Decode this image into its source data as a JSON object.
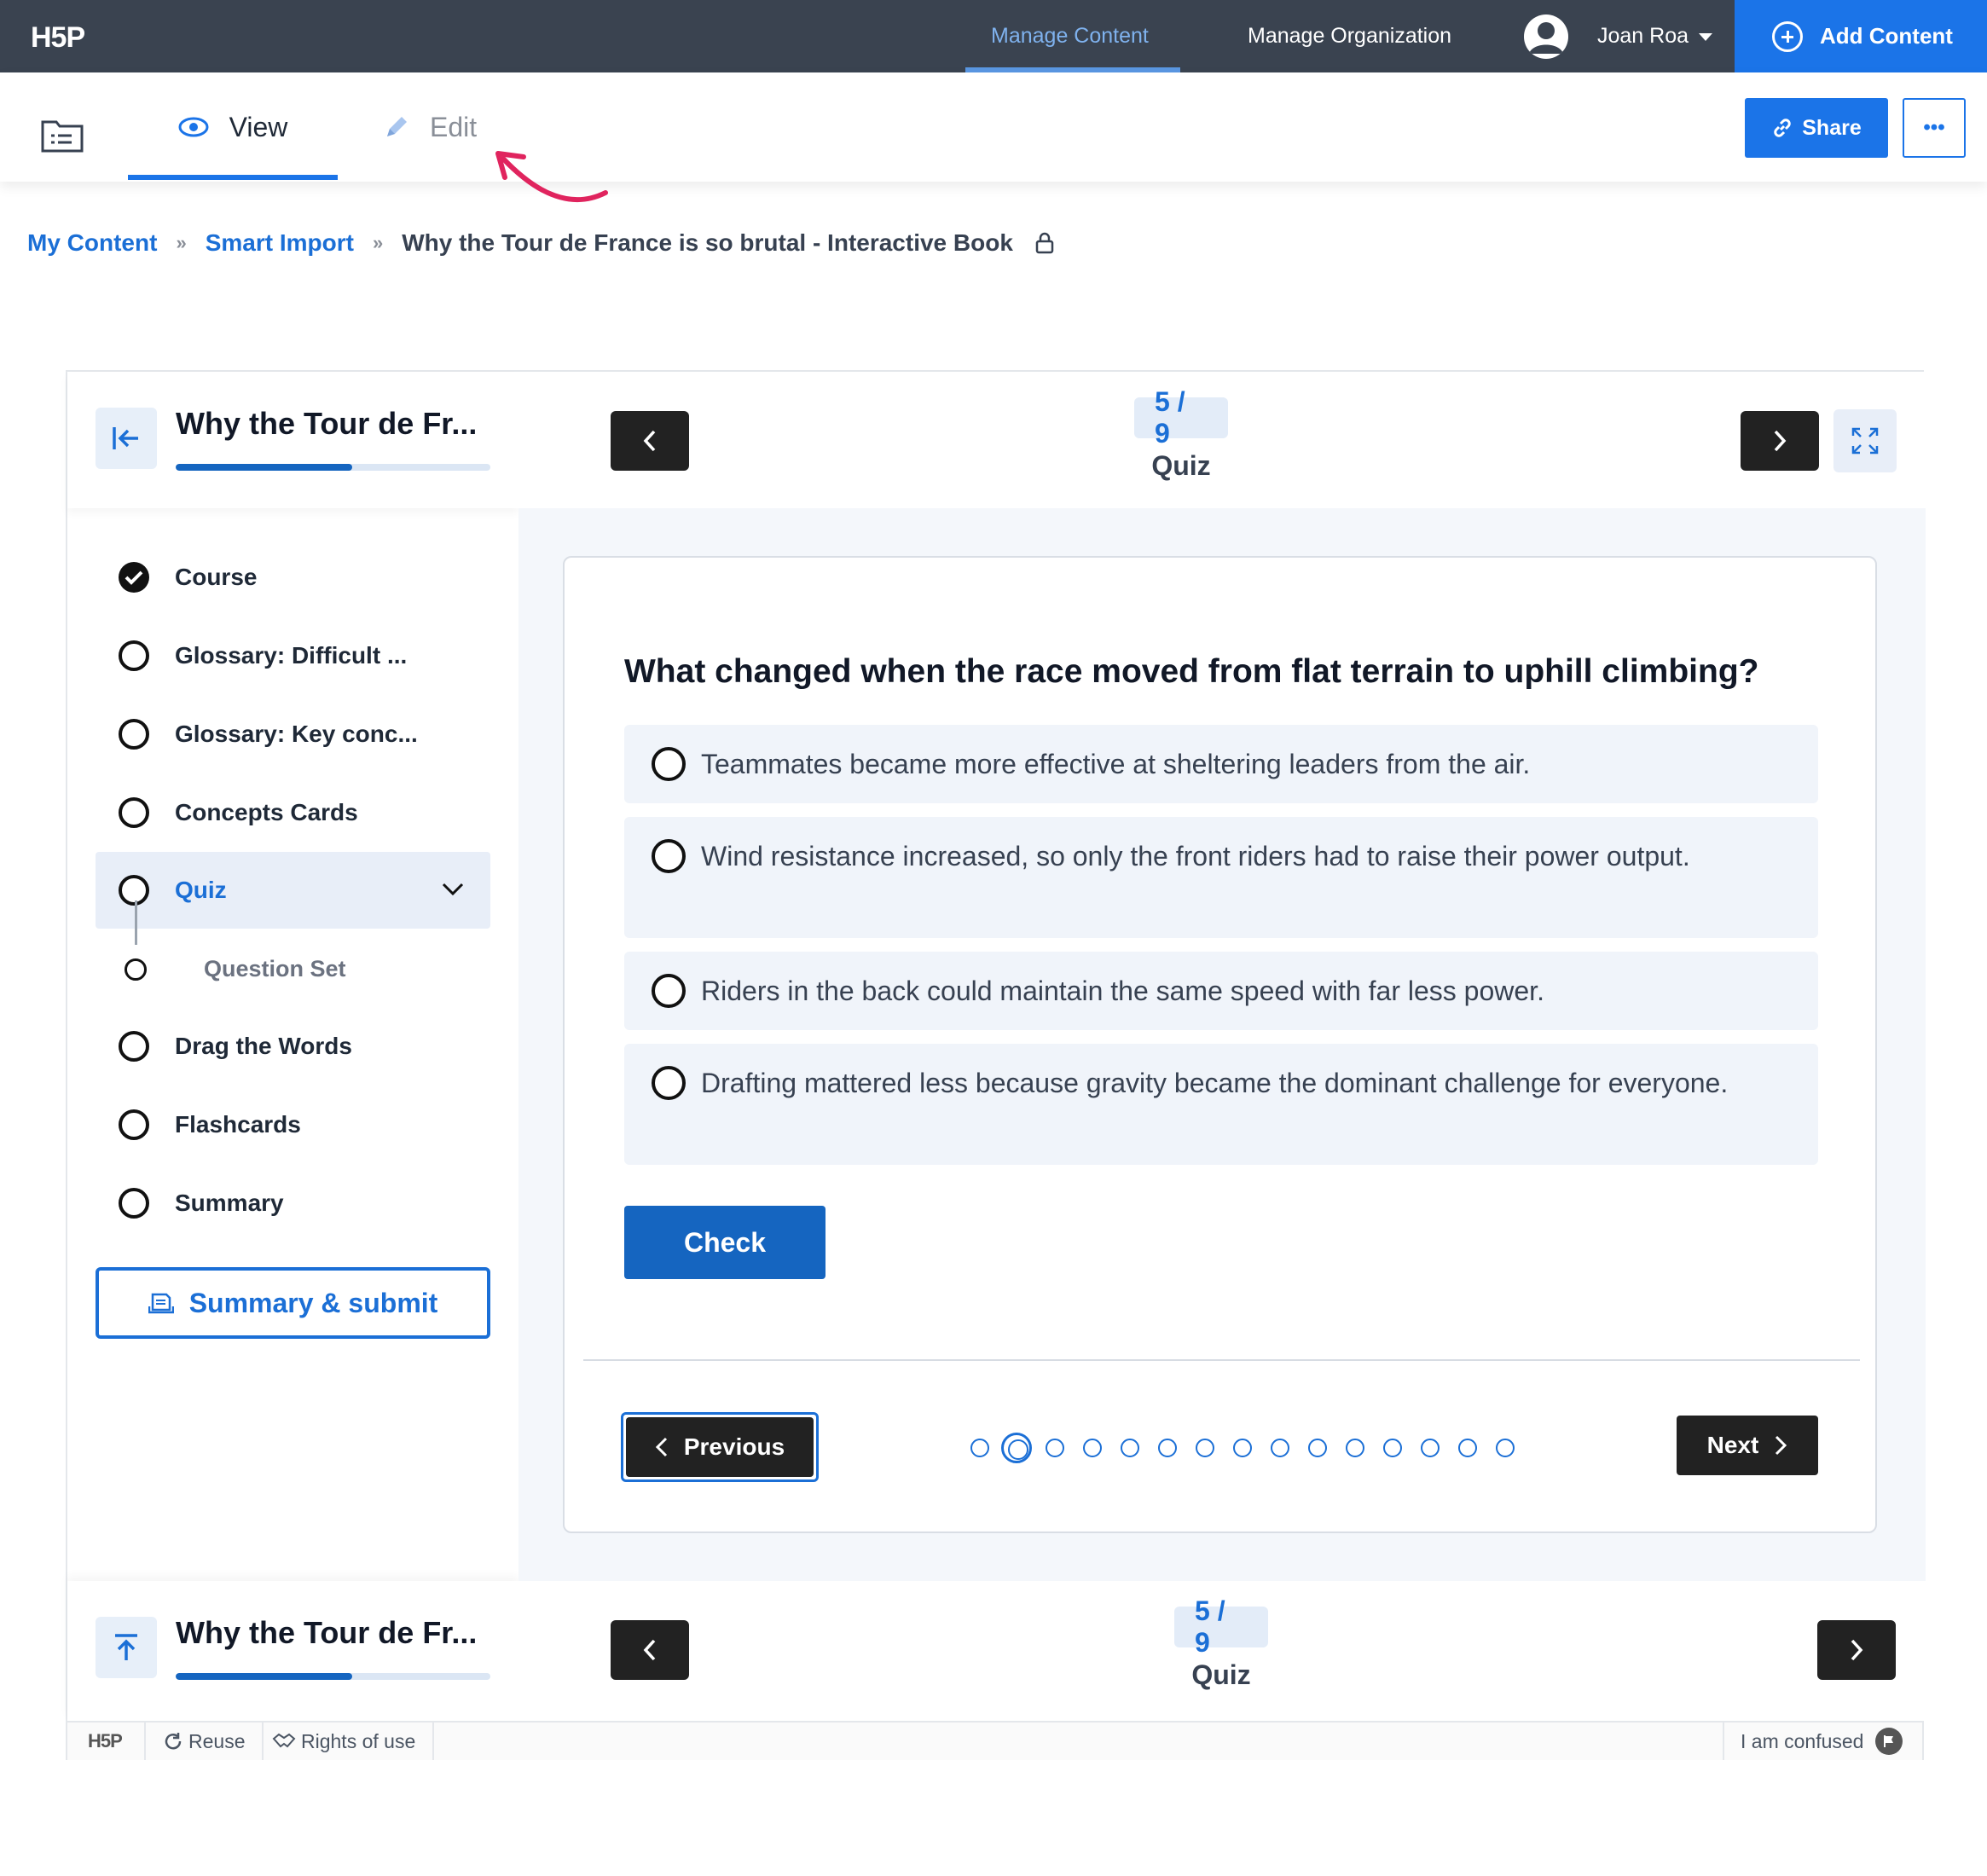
{
  "topbar": {
    "logo": "H5P",
    "nav": [
      "Manage Content",
      "Manage Organization"
    ],
    "user_name": "Joan Roa",
    "add_content": "Add Content"
  },
  "toolbar": {
    "view": "View",
    "edit": "Edit",
    "share": "Share",
    "more": "•••"
  },
  "breadcrumb": {
    "items": [
      "My Content",
      "Smart Import"
    ],
    "separator": "»",
    "current": "Why the Tour de France is so brutal - Interactive Book"
  },
  "book": {
    "title": "Why the Tour de Fr...",
    "progress_percent": 56,
    "chapters": [
      {
        "label": "Course",
        "state": "done"
      },
      {
        "label": "Glossary: Difficult ...",
        "state": "open"
      },
      {
        "label": "Glossary: Key conc...",
        "state": "open"
      },
      {
        "label": "Concepts Cards",
        "state": "open"
      },
      {
        "label": "Quiz",
        "state": "current"
      },
      {
        "label": "Drag the Words",
        "state": "open"
      },
      {
        "label": "Flashcards",
        "state": "open"
      },
      {
        "label": "Summary",
        "state": "open"
      }
    ],
    "sub_item": "Question Set",
    "summary_submit": "Summary & submit",
    "page_counter": "5 / 9",
    "page_title": "Quiz"
  },
  "quiz": {
    "question": "What changed when the race moved from flat terrain to uphill climbing?",
    "options": [
      "Teammates became more effective at sheltering leaders from the air.",
      "Wind resistance increased, so only the front riders had to raise their power output.",
      "Riders in the back could maintain the same speed with far less power.",
      "Drafting mattered less because gravity became the dominant challenge for everyone."
    ],
    "check": "Check",
    "previous": "Previous",
    "next": "Next",
    "total_questions": 15,
    "current_question": 2
  },
  "h5p_bar": {
    "logo": "H5P",
    "reuse": "Reuse",
    "rights": "Rights of use",
    "confused": "I am confused"
  },
  "colors": {
    "topbar": "#3a4350",
    "accent": "#1b74e8",
    "dark_button": "#222222"
  }
}
